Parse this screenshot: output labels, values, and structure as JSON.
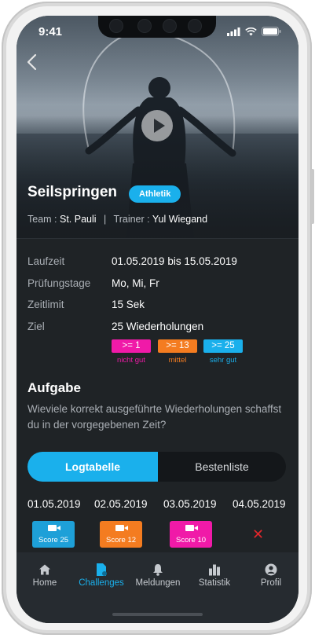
{
  "status_bar": {
    "time": "9:41"
  },
  "hero": {
    "title": "Seilspringen",
    "category_tag": "Athletik",
    "team_label": "Team :",
    "team_value": "St. Pauli",
    "trainer_label": "Trainer :",
    "trainer_value": "Yul Wiegand"
  },
  "details": [
    {
      "label": "Laufzeit",
      "value": "01.05.2019 bis 15.05.2019"
    },
    {
      "label": "Prüfungstage",
      "value": "Mo, Mi, Fr"
    },
    {
      "label": "Zeitlimit",
      "value": "15 Sek"
    },
    {
      "label": "Ziel",
      "value": "25 Wiederholungen"
    }
  ],
  "levels": [
    {
      "badge": ">= 1",
      "caption": "nicht gut",
      "color": "#f01aa8"
    },
    {
      "badge": ">= 13",
      "caption": "mittel",
      "color": "#f47c20"
    },
    {
      "badge": ">= 25",
      "caption": "sehr gut",
      "color": "#1ab0ec"
    }
  ],
  "task": {
    "heading": "Aufgabe",
    "text": "Wieviele korrekt ausgeführte Wiederholungen schaffst du in der vorgegebenen Zeit?"
  },
  "segmented": {
    "left": "Logtabelle",
    "right": "Bestenliste",
    "active": "Logtabelle"
  },
  "log": {
    "dates": [
      "01.05.2019",
      "02.05.2019",
      "03.05.2019",
      "04.05.2019"
    ],
    "scores": [
      {
        "label": "Score 25",
        "color": "#1ea0d8"
      },
      {
        "label": "Score 12",
        "color": "#f47c20"
      },
      {
        "label": "Score 10",
        "color": "#f01aa8"
      }
    ],
    "missing_icon": "cross-icon"
  },
  "tabbar": [
    {
      "label": "Home",
      "icon": "home-icon",
      "active": false
    },
    {
      "label": "Challenges",
      "icon": "document-icon",
      "active": true
    },
    {
      "label": "Meldungen",
      "icon": "bell-icon",
      "active": false
    },
    {
      "label": "Statistik",
      "icon": "bar-chart-icon",
      "active": false
    },
    {
      "label": "Profil",
      "icon": "user-icon",
      "active": false
    }
  ],
  "colors": {
    "accent": "#1ab0ec",
    "background": "#1f2326",
    "tabbar": "#262b30"
  }
}
